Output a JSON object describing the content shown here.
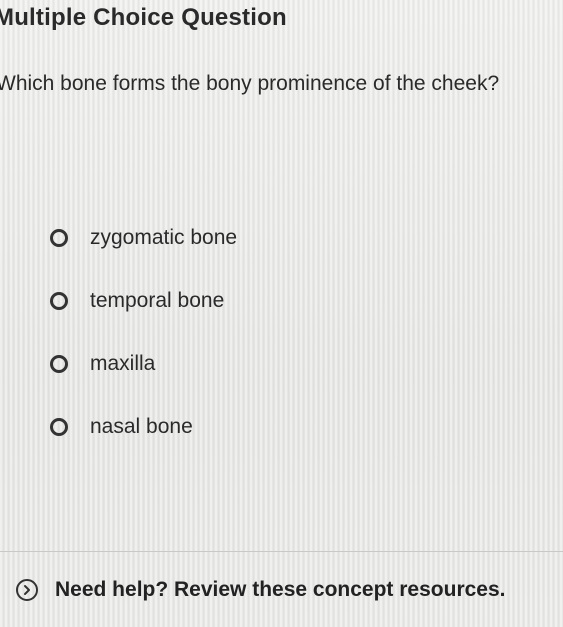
{
  "header": {
    "title": "Multiple Choice Question"
  },
  "question": {
    "text": "Which bone forms the bony prominence of the cheek?"
  },
  "options": [
    {
      "label": "zygomatic bone",
      "selected": false
    },
    {
      "label": "temporal bone",
      "selected": false
    },
    {
      "label": "maxilla",
      "selected": false
    },
    {
      "label": "nasal bone",
      "selected": false
    }
  ],
  "help": {
    "icon": "chevron-right-circle-icon",
    "text": "Need help? Review these concept resources."
  }
}
